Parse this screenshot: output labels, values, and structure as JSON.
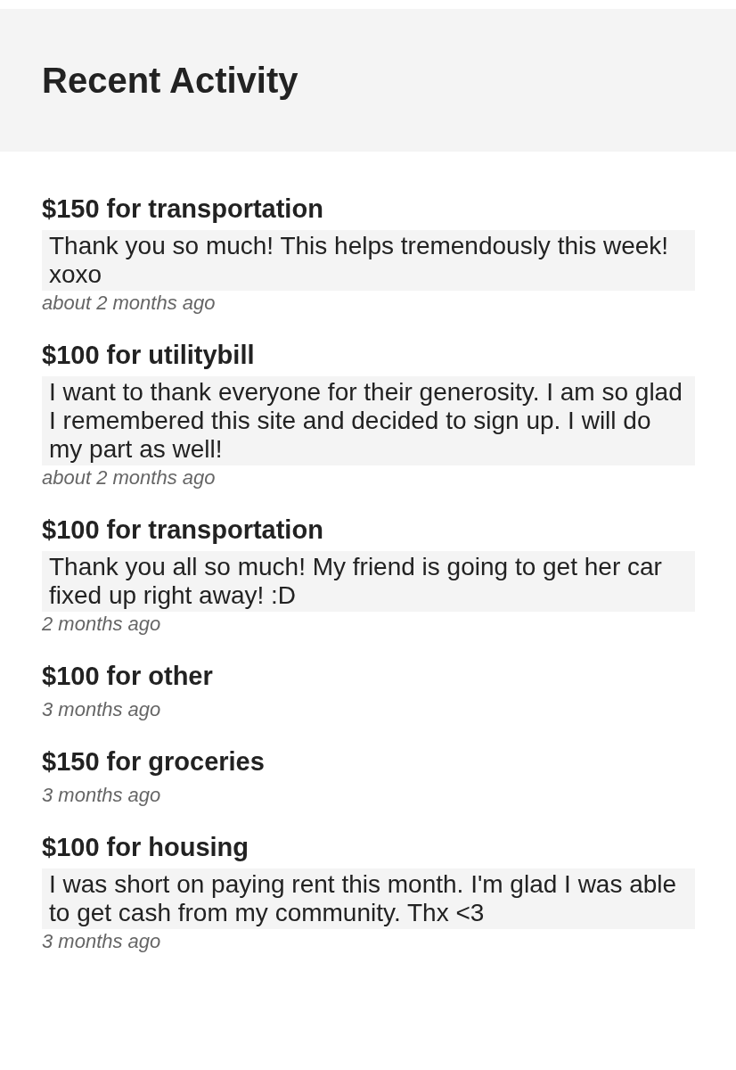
{
  "header": {
    "title": "Recent Activity"
  },
  "activities": [
    {
      "title": "$150 for transportation",
      "message": "Thank you so much! This helps tremendously this week! xoxo",
      "time": "about 2 months ago"
    },
    {
      "title": "$100 for utilitybill",
      "message": "I want to thank everyone for their generosity. I am so glad I remembered this site and decided to sign up. I will do my part as well!",
      "time": "about 2 months ago"
    },
    {
      "title": "$100 for transportation",
      "message": "Thank you all so much! My friend is going to get her car fixed up right away! :D",
      "time": "2 months ago"
    },
    {
      "title": "$100 for other",
      "time": "3 months ago"
    },
    {
      "title": "$150 for groceries",
      "time": "3 months ago"
    },
    {
      "title": "$100 for housing",
      "message": "I was short on paying rent this month. I'm glad I was able to get cash from my community. Thx <3",
      "time": "3 months ago"
    }
  ]
}
